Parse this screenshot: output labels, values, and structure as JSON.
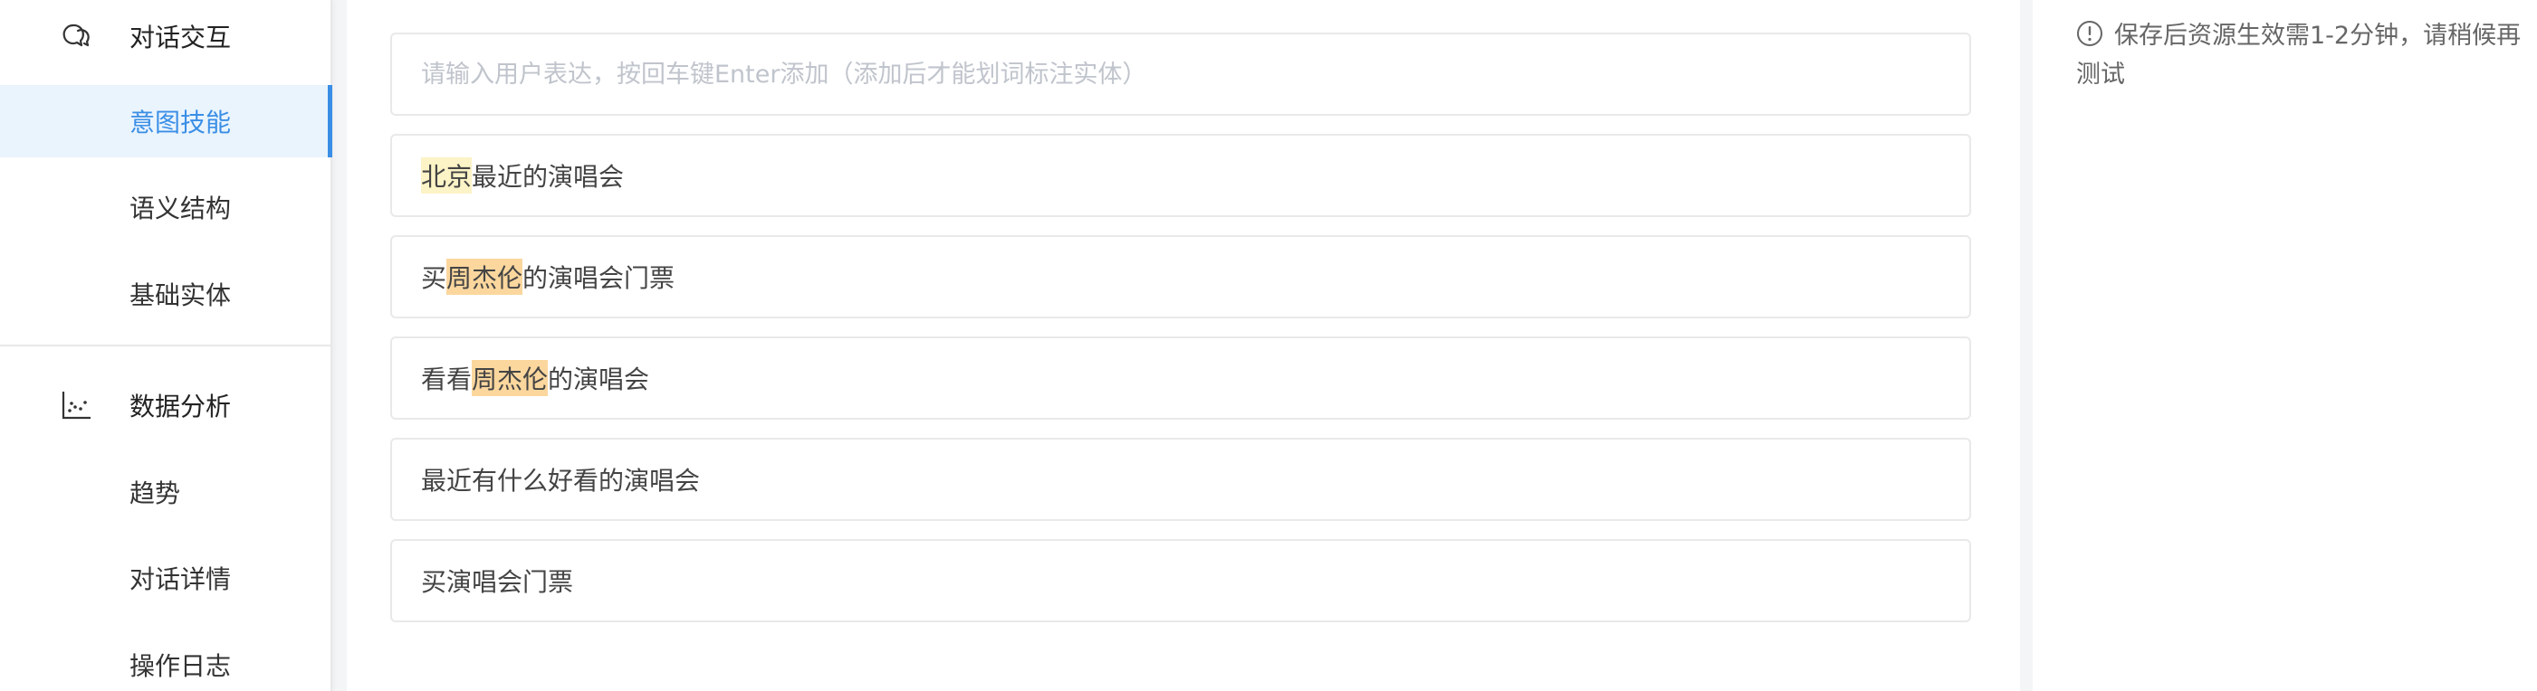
{
  "sidebar": {
    "groups": [
      {
        "title": "对话交互",
        "icon": "chat-bubbles-icon",
        "items": [
          "意图技能",
          "语义结构",
          "基础实体"
        ]
      },
      {
        "title": "数据分析",
        "icon": "scatter-chart-icon",
        "items": [
          "趋势",
          "对话详情",
          "操作日志"
        ]
      }
    ],
    "active_item": "意图技能"
  },
  "main": {
    "input": {
      "placeholder": "请输入用户表达，按回车键Enter添加（添加后才能划词标注实体）",
      "value": ""
    },
    "utterances": [
      {
        "segments": [
          {
            "text": "北京",
            "highlight": "yellow"
          },
          {
            "text": "最近的演唱会"
          }
        ]
      },
      {
        "segments": [
          {
            "text": "买"
          },
          {
            "text": "周杰伦",
            "highlight": "orange"
          },
          {
            "text": "的演唱会门票"
          }
        ]
      },
      {
        "segments": [
          {
            "text": "看看"
          },
          {
            "text": "周杰伦",
            "highlight": "orange"
          },
          {
            "text": "的演唱会"
          }
        ]
      },
      {
        "segments": [
          {
            "text": "最近有什么好看的演唱会"
          }
        ]
      },
      {
        "segments": [
          {
            "text": "买演唱会门票"
          }
        ]
      }
    ]
  },
  "right_panel": {
    "notice": "保存后资源生效需1-2分钟，请稍候再测试",
    "notice_icon": "info-circle-icon"
  },
  "colors": {
    "accent": "#3a8ee6",
    "active_bg": "#eaf4fd",
    "entity_location": "#fcf3c6",
    "entity_person": "#fbd79e"
  }
}
